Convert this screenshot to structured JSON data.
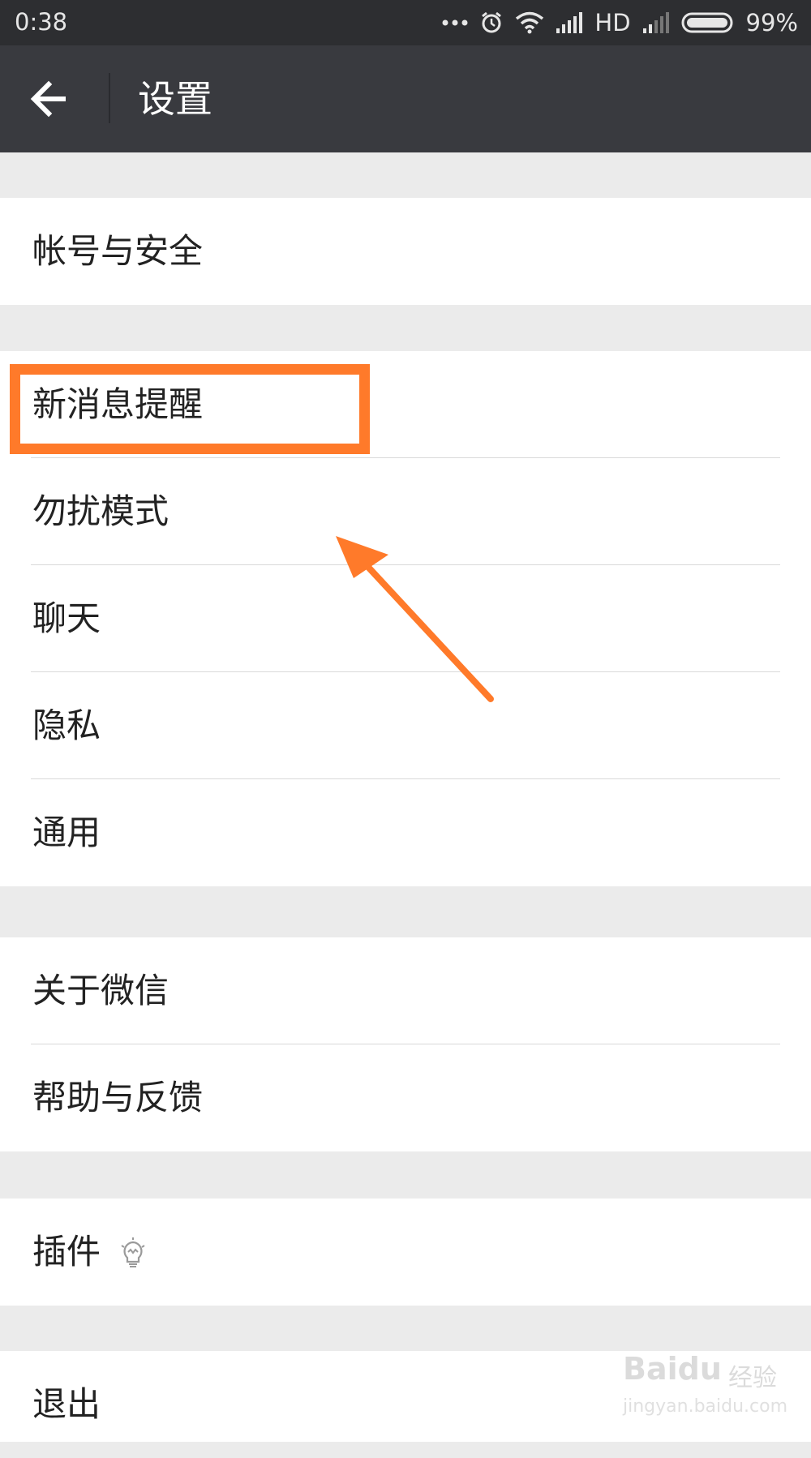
{
  "status_bar": {
    "time": "0:38",
    "network_label": "HD",
    "battery_percent": "99%",
    "icons": [
      "more-dots-icon",
      "alarm-icon",
      "wifi-icon",
      "signal-icon",
      "signal-weak-icon",
      "battery-icon"
    ]
  },
  "app_bar": {
    "title": "设置",
    "back_icon": "back-arrow-icon"
  },
  "groups": [
    {
      "items": [
        "帐号与安全"
      ]
    },
    {
      "items": [
        "新消息提醒",
        "勿扰模式",
        "聊天",
        "隐私",
        "通用"
      ]
    },
    {
      "items": [
        "关于微信",
        "帮助与反馈"
      ]
    },
    {
      "items": [
        "插件"
      ]
    },
    {
      "items": [
        "退出"
      ]
    }
  ],
  "annotation": {
    "highlighted_item": "新消息提醒",
    "color": "#ff7a2a"
  },
  "watermark": {
    "brand": "Baidu",
    "cn": "经验",
    "url": "jingyan.baidu.com"
  },
  "colors": {
    "status_bar": "#2d2e31",
    "app_bar": "#393a3f",
    "background": "#ebebeb",
    "row": "#ffffff"
  }
}
